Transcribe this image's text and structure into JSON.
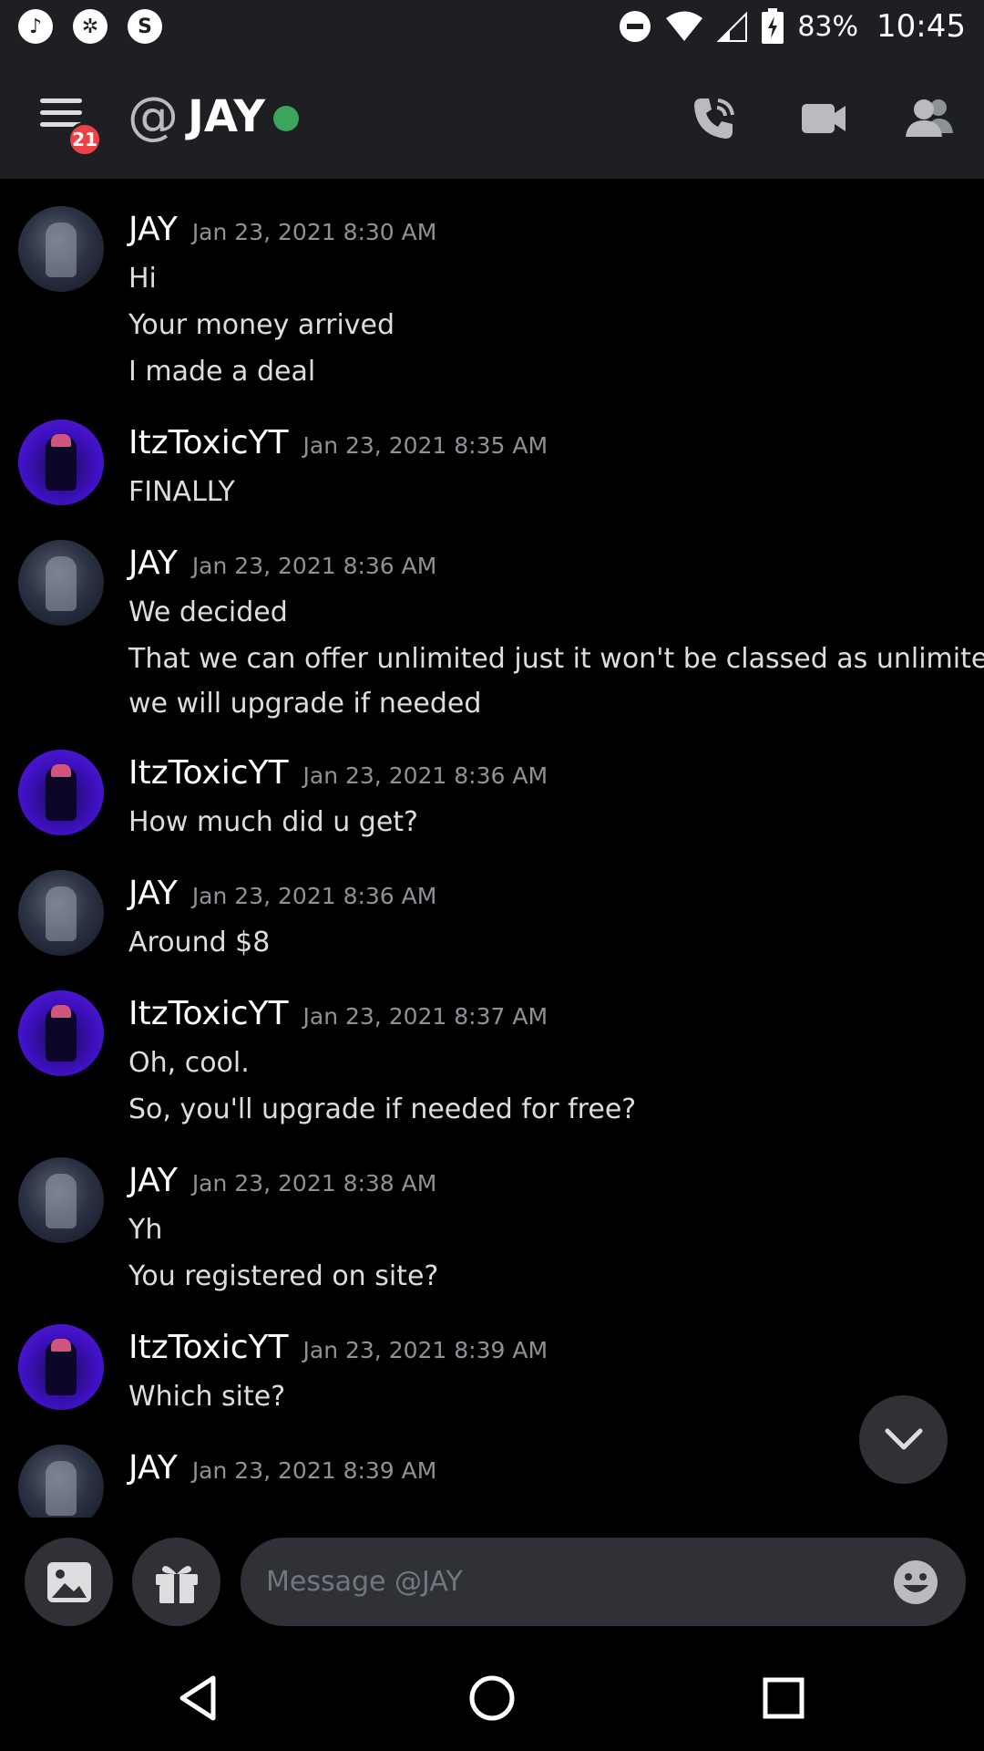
{
  "status_bar": {
    "battery": "83%",
    "time": "10:45"
  },
  "header": {
    "channel_name": "JAY",
    "notification_count": "21",
    "at_symbol": "@"
  },
  "messages": [
    {
      "author": "JAY",
      "avatar": "jay",
      "timestamp": "Jan 23, 2021 8:30 AM",
      "lines": [
        "Hi",
        "Your money arrived",
        "I made a deal"
      ]
    },
    {
      "author": "ItzToxicYT",
      "avatar": "itz",
      "timestamp": "Jan 23, 2021 8:35 AM",
      "lines": [
        "FINALLY"
      ]
    },
    {
      "author": "JAY",
      "avatar": "jay",
      "timestamp": "Jan 23, 2021 8:36 AM",
      "lines": [
        "We decided",
        "That we can offer unlimited just it won't be classed as unlimited",
        "we will upgrade if needed"
      ]
    },
    {
      "author": "ItzToxicYT",
      "avatar": "itz",
      "timestamp": "Jan 23, 2021 8:36 AM",
      "lines": [
        "How much did u get?"
      ]
    },
    {
      "author": "JAY",
      "avatar": "jay",
      "timestamp": "Jan 23, 2021 8:36 AM",
      "lines": [
        "Around $8"
      ]
    },
    {
      "author": "ItzToxicYT",
      "avatar": "itz",
      "timestamp": "Jan 23, 2021 8:37 AM",
      "lines": [
        "Oh, cool.",
        "So, you'll upgrade if needed for free?"
      ]
    },
    {
      "author": "JAY",
      "avatar": "jay",
      "timestamp": "Jan 23, 2021 8:38 AM",
      "lines": [
        "Yh",
        "You registered on site?"
      ]
    },
    {
      "author": "ItzToxicYT",
      "avatar": "itz",
      "timestamp": "Jan 23, 2021 8:39 AM",
      "lines": [
        "Which site?"
      ]
    },
    {
      "author": "JAY",
      "avatar": "jay",
      "timestamp": "Jan 23, 2021 8:39 AM",
      "lines": []
    }
  ],
  "composer": {
    "placeholder": "Message @JAY"
  },
  "icons": {
    "status_left": [
      "tiktok-icon",
      "aperture-icon",
      "shazam-icon"
    ],
    "status_right": [
      "do-not-disturb-icon",
      "wifi-icon",
      "signal-icon",
      "battery-icon"
    ],
    "header_right": [
      "voice-call-icon",
      "video-call-icon",
      "members-icon"
    ]
  },
  "colors": {
    "background": "#000000",
    "header": "#1e1f22",
    "online": "#3ba55c",
    "badge": "#ed4245",
    "timestamp": "#8e9297",
    "link": "#00aff4"
  }
}
